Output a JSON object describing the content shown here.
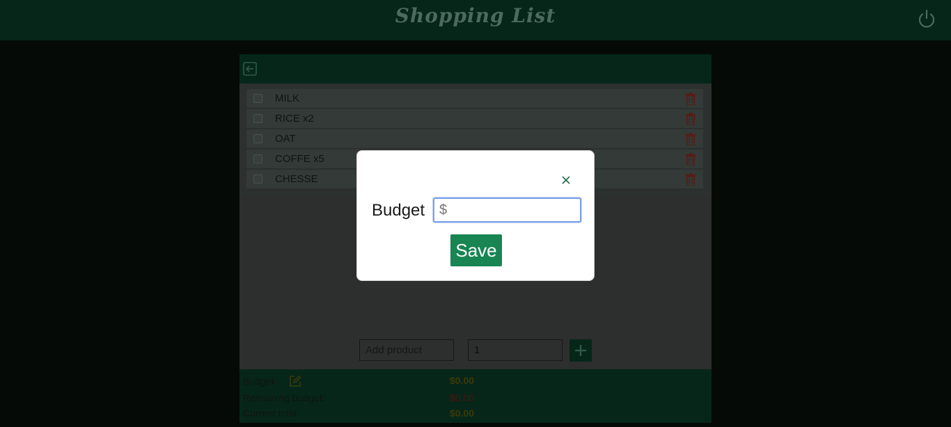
{
  "header": {
    "title": "Shopping List",
    "power_icon": "power-icon"
  },
  "panel": {
    "back_icon": "back-arrow-icon",
    "items": [
      {
        "name": "MILK",
        "checked": false
      },
      {
        "name": "RICE x2",
        "checked": false
      },
      {
        "name": "OAT",
        "checked": false
      },
      {
        "name": "COFFE x5",
        "checked": false
      },
      {
        "name": "CHESSE",
        "checked": false
      }
    ],
    "add_product_placeholder": "Add product",
    "quantity_value": "1",
    "add_icon": "plus-icon"
  },
  "summary": {
    "budget_label": "Budget :",
    "budget_value": "$0.00",
    "remaining_label": "Remaining budget:",
    "remaining_value": "$0.00",
    "total_label": "Current total:",
    "total_value": "$0.00"
  },
  "modal": {
    "budget_label": "Budget",
    "budget_placeholder": "$",
    "save_label": "Save",
    "close_icon": "close-icon"
  },
  "colors": {
    "header_bg": "#06261a",
    "accent_green": "#188552",
    "trash_red": "#5a1a14",
    "remaining_red": "#4a1410"
  }
}
